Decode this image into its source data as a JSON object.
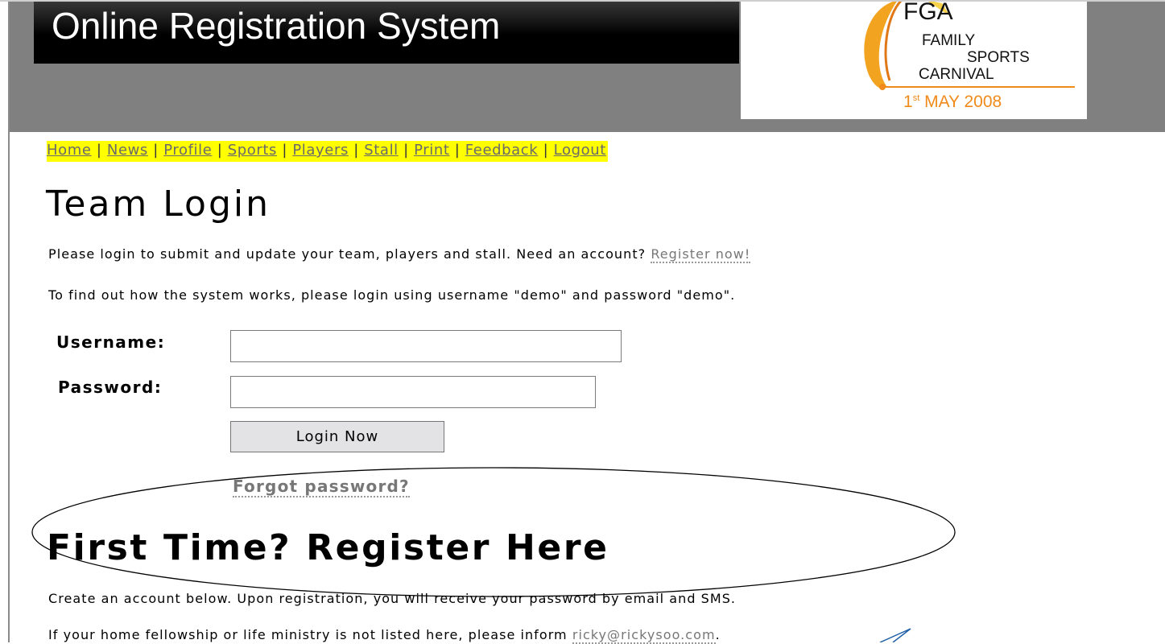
{
  "header": {
    "site_title": "Online Registration System",
    "logo": {
      "line1": "FGA",
      "line2": "FAMILY",
      "line3": "SPORTS",
      "line4": "CARNIVAL",
      "date_day": "1",
      "date_suffix": "st",
      "date_rest": " MAY 2008",
      "accent_color": "#f08a1a"
    }
  },
  "nav": {
    "separator": " | ",
    "items": [
      "Home",
      "News",
      "Profile",
      "Sports",
      "Players",
      "Stall",
      "Print",
      "Feedback",
      "Logout"
    ],
    "highlight_color": "#ffff00"
  },
  "login": {
    "heading": "Team Login",
    "intro_text": "Please login to submit and update your team, players and stall.  Need an account? ",
    "register_link": "Register now!",
    "demo_text": "To find out how the system works, please login using username \"demo\" and password \"demo\".",
    "username_label": "Username:",
    "username_value": "",
    "password_label": "Password:",
    "password_value": "",
    "button_label": "Login Now",
    "forgot_link": "Forgot password?"
  },
  "register": {
    "heading": "First Time? Register Here",
    "text": "Create an account below.  Upon registration, you will receive your password by email and SMS.",
    "note_text": "If your home fellowship or life ministry is not listed here, please inform ",
    "email_link": "ricky@rickysoo.com",
    "note_end": "."
  }
}
